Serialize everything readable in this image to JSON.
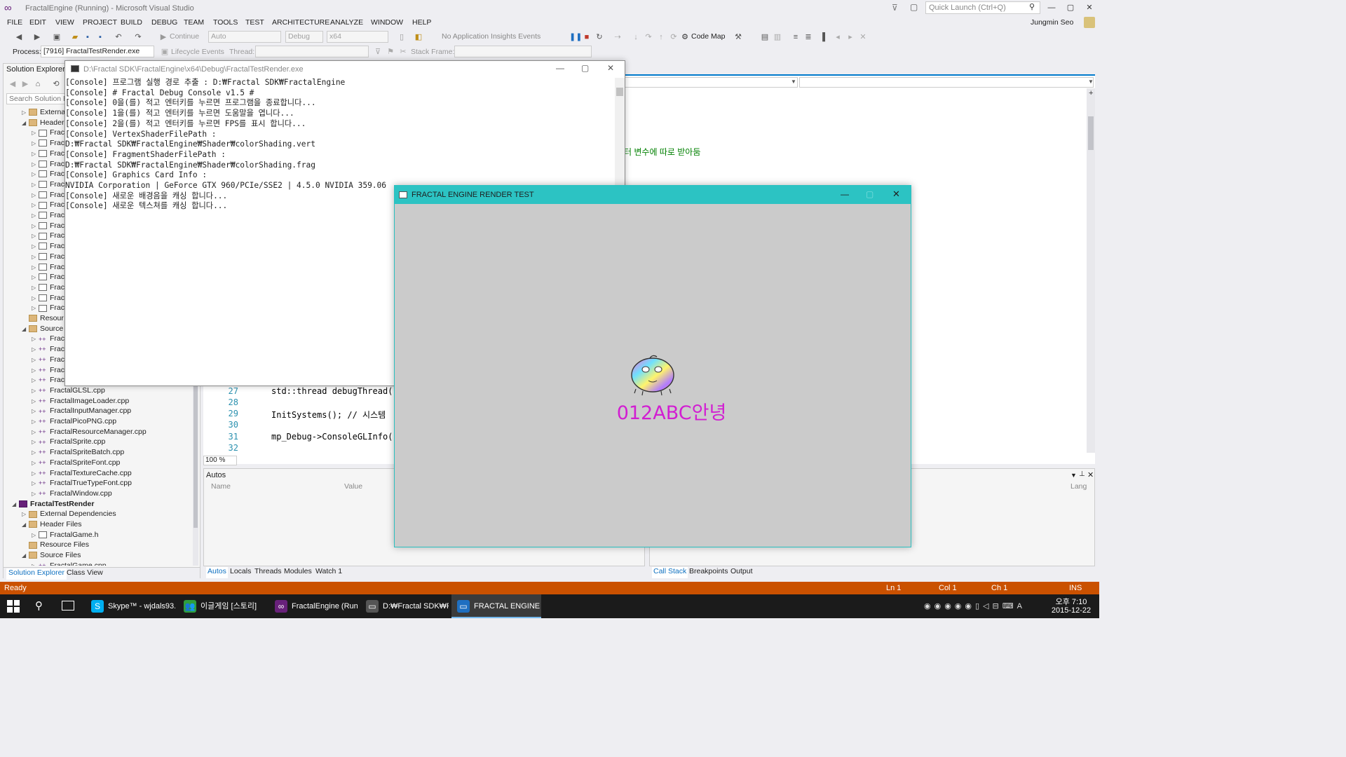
{
  "title_bar": {
    "title": "FractalEngine (Running) - Microsoft Visual Studio",
    "quick_launch": "Quick Launch (Ctrl+Q)",
    "user": "Jungmin Seo"
  },
  "menu": [
    "FILE",
    "EDIT",
    "VIEW",
    "PROJECT",
    "BUILD",
    "DEBUG",
    "TEAM",
    "TOOLS",
    "TEST",
    "ARCHITECTURE",
    "ANALYZE",
    "WINDOW",
    "HELP"
  ],
  "toolbar": {
    "continue": "Continue",
    "solution_config": "Auto",
    "config": "Debug",
    "platform": "x64",
    "insights": "No Application Insights Events",
    "code_map": "Code Map"
  },
  "debug_toolbar": {
    "process_label": "Process:",
    "process_value": "[7916] FractalTestRender.exe",
    "lifecycle": "Lifecycle Events",
    "thread_label": "Thread:",
    "stack_label": "Stack Frame:"
  },
  "solution_explorer": {
    "title": "Solution Explorer",
    "search_placeholder": "Search Solution Ex",
    "tree": [
      {
        "label": "Externa",
        "indent": 1,
        "icon": "folder",
        "arrow": "▷"
      },
      {
        "label": "Header",
        "indent": 1,
        "icon": "folder",
        "arrow": "◢"
      },
      {
        "label": "Frac",
        "indent": 2,
        "icon": "h",
        "arrow": "▷"
      },
      {
        "label": "Frac",
        "indent": 2,
        "icon": "h",
        "arrow": "▷"
      },
      {
        "label": "Frac",
        "indent": 2,
        "icon": "h",
        "arrow": "▷"
      },
      {
        "label": "Frac",
        "indent": 2,
        "icon": "h",
        "arrow": "▷"
      },
      {
        "label": "Frac",
        "indent": 2,
        "icon": "h",
        "arrow": "▷"
      },
      {
        "label": "Frac",
        "indent": 2,
        "icon": "h",
        "arrow": "▷"
      },
      {
        "label": "Frac",
        "indent": 2,
        "icon": "h",
        "arrow": "▷"
      },
      {
        "label": "Frac",
        "indent": 2,
        "icon": "h",
        "arrow": "▷"
      },
      {
        "label": "Frac",
        "indent": 2,
        "icon": "h",
        "arrow": "▷"
      },
      {
        "label": "Frac",
        "indent": 2,
        "icon": "h",
        "arrow": "▷"
      },
      {
        "label": "Frac",
        "indent": 2,
        "icon": "h",
        "arrow": "▷"
      },
      {
        "label": "Frac",
        "indent": 2,
        "icon": "h",
        "arrow": "▷"
      },
      {
        "label": "Frac",
        "indent": 2,
        "icon": "h",
        "arrow": "▷"
      },
      {
        "label": "Frac",
        "indent": 2,
        "icon": "h",
        "arrow": "▷"
      },
      {
        "label": "Frac",
        "indent": 2,
        "icon": "h",
        "arrow": "▷"
      },
      {
        "label": "Frac",
        "indent": 2,
        "icon": "h",
        "arrow": "▷"
      },
      {
        "label": "Frac",
        "indent": 2,
        "icon": "h",
        "arrow": "▷"
      },
      {
        "label": "Frac",
        "indent": 2,
        "icon": "h",
        "arrow": "▷"
      },
      {
        "label": "Resour",
        "indent": 1,
        "icon": "folder",
        "arrow": ""
      },
      {
        "label": "Source",
        "indent": 1,
        "icon": "folder",
        "arrow": "◢"
      },
      {
        "label": "Frac",
        "indent": 2,
        "icon": "c",
        "arrow": "▷"
      },
      {
        "label": "Frac",
        "indent": 2,
        "icon": "c",
        "arrow": "▷"
      },
      {
        "label": "Frac",
        "indent": 2,
        "icon": "c",
        "arrow": "▷"
      },
      {
        "label": "Frac",
        "indent": 2,
        "icon": "c",
        "arrow": "▷"
      },
      {
        "label": "Frac",
        "indent": 2,
        "icon": "c",
        "arrow": "▷"
      },
      {
        "label": "FractalGLSL.cpp",
        "indent": 2,
        "icon": "c",
        "arrow": "▷"
      },
      {
        "label": "FractalImageLoader.cpp",
        "indent": 2,
        "icon": "c",
        "arrow": "▷"
      },
      {
        "label": "FractalInputManager.cpp",
        "indent": 2,
        "icon": "c",
        "arrow": "▷"
      },
      {
        "label": "FractalPicoPNG.cpp",
        "indent": 2,
        "icon": "c",
        "arrow": "▷"
      },
      {
        "label": "FractalResourceManager.cpp",
        "indent": 2,
        "icon": "c",
        "arrow": "▷"
      },
      {
        "label": "FractalSprite.cpp",
        "indent": 2,
        "icon": "c",
        "arrow": "▷"
      },
      {
        "label": "FractalSpriteBatch.cpp",
        "indent": 2,
        "icon": "c",
        "arrow": "▷"
      },
      {
        "label": "FractalSpriteFont.cpp",
        "indent": 2,
        "icon": "c",
        "arrow": "▷"
      },
      {
        "label": "FractalTextureCache.cpp",
        "indent": 2,
        "icon": "c",
        "arrow": "▷"
      },
      {
        "label": "FractalTrueTypeFont.cpp",
        "indent": 2,
        "icon": "c",
        "arrow": "▷"
      },
      {
        "label": "FractalWindow.cpp",
        "indent": 2,
        "icon": "c",
        "arrow": "▷"
      },
      {
        "label": "FractalTestRender",
        "indent": 0,
        "icon": "proj",
        "arrow": "◢",
        "bold": true
      },
      {
        "label": "External Dependencies",
        "indent": 1,
        "icon": "folder",
        "arrow": "▷"
      },
      {
        "label": "Header Files",
        "indent": 1,
        "icon": "folder",
        "arrow": "◢"
      },
      {
        "label": "FractalGame.h",
        "indent": 2,
        "icon": "h",
        "arrow": "▷"
      },
      {
        "label": "Resource Files",
        "indent": 1,
        "icon": "folder",
        "arrow": ""
      },
      {
        "label": "Source Files",
        "indent": 1,
        "icon": "folder",
        "arrow": "◢"
      },
      {
        "label": "FractalGame.cpp",
        "indent": 2,
        "icon": "c",
        "arrow": "▷"
      }
    ],
    "tab_solution": "Solution Explorer",
    "tab_class": "Class View"
  },
  "editor": {
    "comment_tail": "터 변수에 따로 받아둠",
    "lines": [
      {
        "no": "27",
        "code": "std::thread debugThread("
      },
      {
        "no": "28",
        "code": ""
      },
      {
        "no": "29",
        "code": "InitSystems(); // 시스템"
      },
      {
        "no": "30",
        "code": ""
      },
      {
        "no": "31",
        "code": "mp_Debug->ConsoleGLInfo("
      },
      {
        "no": "32",
        "code": ""
      }
    ],
    "zoom": "100 %"
  },
  "autos": {
    "title": "Autos",
    "col_name": "Name",
    "col_value": "Value",
    "tabs": [
      "Autos",
      "Locals",
      "Threads",
      "Modules",
      "Watch 1"
    ]
  },
  "callstack": {
    "col_lang": "Lang",
    "tabs": [
      "Call Stack",
      "Breakpoints",
      "Output"
    ]
  },
  "console": {
    "title": "D:\\Fractal SDK\\FractalEngine\\x64\\Debug\\FractalTestRender.exe",
    "text": "[Console] 프로그램 실행 경로 추출 : D:₩Fractal SDK₩FractalEngine\n[Console] # Fractal Debug Console v1.5 #\n[Console] 0을(를) 적고 엔터키를 누르면 프로그램을 종료합니다...\n[Console] 1을(를) 적고 엔터키를 누르면 도움말을 엽니다...\n[Console] 2을(를) 적고 엔터키를 누르면 FPS를 표시 합니다...\n[Console] VertexShaderFilePath :\nD:₩Fractal SDK₩FractalEngine₩Shader₩colorShading.vert\n[Console] FragmentShaderFilePath :\nD:₩Fractal SDK₩FractalEngine₩Shader₩colorShading.frag\n[Console] Graphics Card Info :\nNVIDIA Corporation | GeForce GTX 960/PCIe/SSE2 | 4.5.0 NVIDIA 359.06\n[Console] 새로운 배경음을 캐싱 합니다...\n[Console] 새로운 텍스쳐를 캐싱 합니다..."
  },
  "render_window": {
    "title": "FRACTAL ENGINE RENDER TEST",
    "text": "012ABC안녕",
    "text_color": "#d21ed2",
    "bg": "#cbcbcb",
    "title_bg": "#2cc3c3"
  },
  "status": {
    "ready": "Ready",
    "ln": "Ln 1",
    "col": "Col 1",
    "ch": "Ch 1",
    "ins": "INS"
  },
  "taskbar": {
    "apps": [
      {
        "label": "Skype™ - wjdals93...",
        "icon": "S",
        "color": "#00aff0"
      },
      {
        "label": "이글게임 [스토리]",
        "icon": "👥",
        "color": "#2e9e3e"
      },
      {
        "label": "FractalEngine (Run...",
        "icon": "∞",
        "color": "#68217a"
      },
      {
        "label": "D:₩Fractal SDK₩Fr...",
        "icon": "▭",
        "color": "#555"
      },
      {
        "label": "FRACTAL ENGINE ...",
        "icon": "▭",
        "color": "#1e6fc1",
        "active": true
      }
    ],
    "clock_time": "오후 7:10",
    "clock_date": "2015-12-22"
  }
}
